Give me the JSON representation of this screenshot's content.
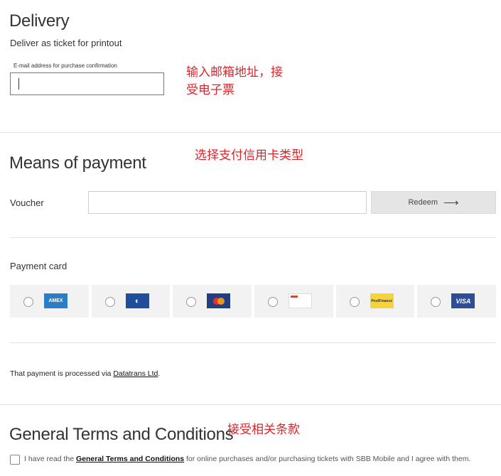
{
  "delivery": {
    "title": "Delivery",
    "subtitle": "Deliver as ticket for printout",
    "email_label": "E-mail address for purchase confirmation",
    "email_value": "",
    "annotation_line1": "输入邮箱地址，接",
    "annotation_line2": "受电子票"
  },
  "payment": {
    "title": "Means of payment",
    "annotation": "选择支付信用卡类型",
    "voucher_label": "Voucher",
    "voucher_value": "",
    "redeem_label": "Redeem",
    "redeem_arrow": "⟶",
    "payment_card_label": "Payment card",
    "cards": [
      {
        "name": "amex",
        "text": "AMEX",
        "bg": "#2a7ec3",
        "fg": "#ffffff"
      },
      {
        "name": "diners",
        "text": "◐",
        "bg": "#1f4f9c",
        "fg": "#ffffff"
      },
      {
        "name": "mastercard",
        "text": "MC",
        "bg": "#213f80",
        "fg": "#f2a23a"
      },
      {
        "name": "other-card",
        "text": "card",
        "bg": "#ffffff",
        "fg": "#d14a3a"
      },
      {
        "name": "postfinance",
        "text": "PostFinance",
        "bg": "#f6d33a",
        "fg": "#333333"
      },
      {
        "name": "visa",
        "text": "VISA",
        "bg": "#2d4d97",
        "fg": "#ffffff"
      }
    ],
    "processed_prefix": "That payment is processed via ",
    "processed_link": "Datatrans Ltd",
    "processed_suffix": "."
  },
  "terms": {
    "title": "General Terms and Conditions",
    "annotation": "接受相关条款",
    "text_prefix": "I have read the ",
    "text_link": "General Terms and Conditions",
    "text_suffix": " for online purchases and/or purchasing tickets with SBB Mobile and I agree with them."
  }
}
